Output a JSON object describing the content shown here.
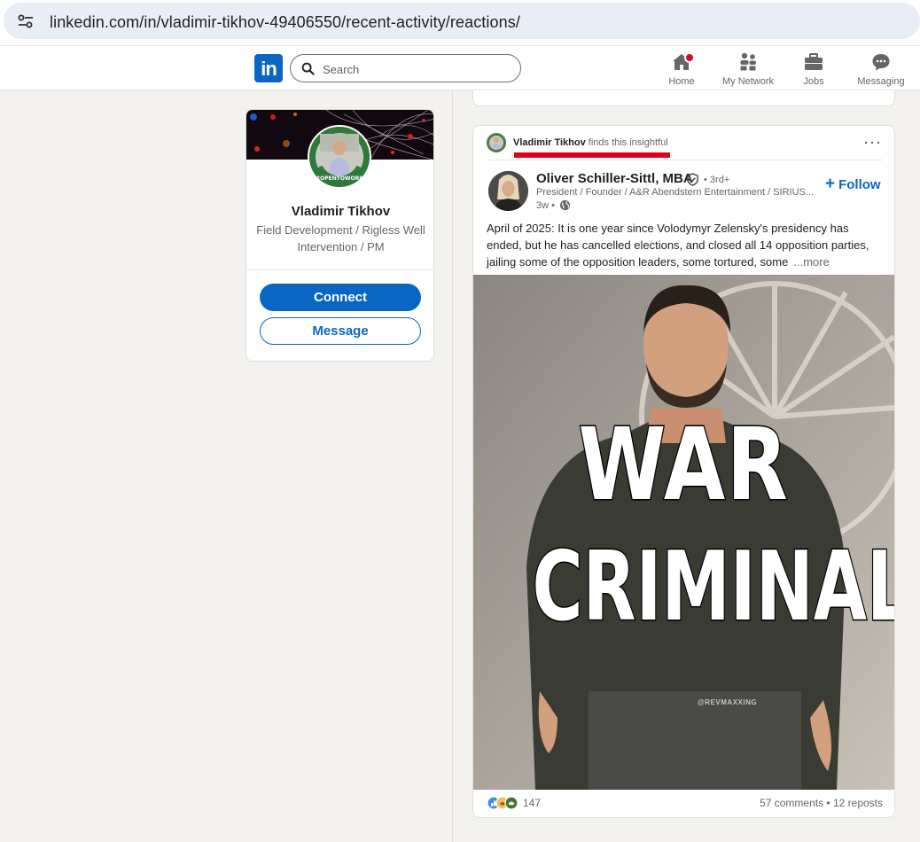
{
  "browser": {
    "url": "linkedin.com/in/vladimir-tikhov-49406550/recent-activity/reactions/"
  },
  "nav": {
    "logo": "in",
    "search_placeholder": "Search",
    "items": [
      {
        "label": "Home",
        "icon": "home-icon"
      },
      {
        "label": "My Network",
        "icon": "network-icon"
      },
      {
        "label": "Jobs",
        "icon": "briefcase-icon"
      },
      {
        "label": "Messaging",
        "icon": "messaging-icon"
      }
    ]
  },
  "profile": {
    "name": "Vladimir Tikhov",
    "headline": "Field Development / Rigless Well Intervention / PM",
    "avatar_frame_text": "#OPENTOWORK",
    "connect_label": "Connect",
    "message_label": "Message"
  },
  "post": {
    "reactor_name": "Vladimir Tikhov",
    "reaction_text": " finds this insightful",
    "menu_glyph": "···",
    "author": {
      "name": "Oliver Schiller-Sittl, MBA",
      "degree": "• 3rd+",
      "headline": "President / Founder / A&R Abendstern Entertainment / SIRIUS...",
      "age": "3w •"
    },
    "follow_label": "Follow",
    "follow_glyph": "+",
    "body": "April of 2025: It is one year since Volodymyr Zelensky's presidency has ended, but he has cancelled elections, and closed all 14 opposition parties, jailing some of the opposition leaders, some tortured, some",
    "see_more": "...more",
    "image_text_line1": "WAR",
    "image_text_line2": "CRIMINAL",
    "image_watermark": "@REVMAXXING",
    "reaction_count": "147",
    "comments_reposts": "57 comments • 12 reposts"
  },
  "colors": {
    "brand": "#0a66c2",
    "background": "#f4f2ee",
    "highlight_underline": "#e3001b",
    "notification": "#cb112d"
  }
}
